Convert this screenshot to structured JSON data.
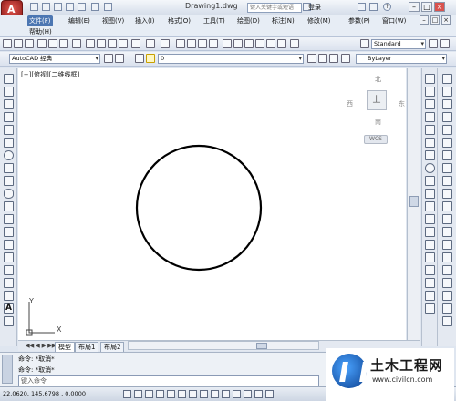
{
  "titlebar": {
    "app_letter": "A",
    "doc_title": "Drawing1.dwg",
    "search_placeholder": "键入关键字或短语",
    "login_label": "登录",
    "help_label": "?"
  },
  "menu": {
    "items": [
      "文件(F)",
      "编辑(E)",
      "视图(V)",
      "插入(I)",
      "格式(O)",
      "工具(T)",
      "绘图(D)",
      "标注(N)",
      "修改(M)",
      "参数(P)",
      "窗口(W)"
    ],
    "second_row": [
      "帮助(H)"
    ],
    "active_index": 0
  },
  "toolbar2": {
    "workspace": "AutoCAD 经典",
    "layer": "0",
    "text_style": "Standard",
    "color": "ByLayer"
  },
  "canvas": {
    "viewport_label": "[−][俯视][二维线框]",
    "viewcube": {
      "north": "北",
      "south": "南",
      "east": "东",
      "west": "西",
      "top_face": "上",
      "wcs": "WCS"
    },
    "ucs": {
      "x": "X",
      "y": "Y"
    }
  },
  "tabs": [
    "模型",
    "布局1",
    "布局2"
  ],
  "command": {
    "history_1": "命令: *取消*",
    "history_2": "命令: *取消*",
    "input_placeholder": "键入命令"
  },
  "status": {
    "coordinates": "22.0620, 145.6798 , 0.0000"
  },
  "watermark": {
    "title": "土木工程网",
    "url": "www.civilcn.com"
  }
}
